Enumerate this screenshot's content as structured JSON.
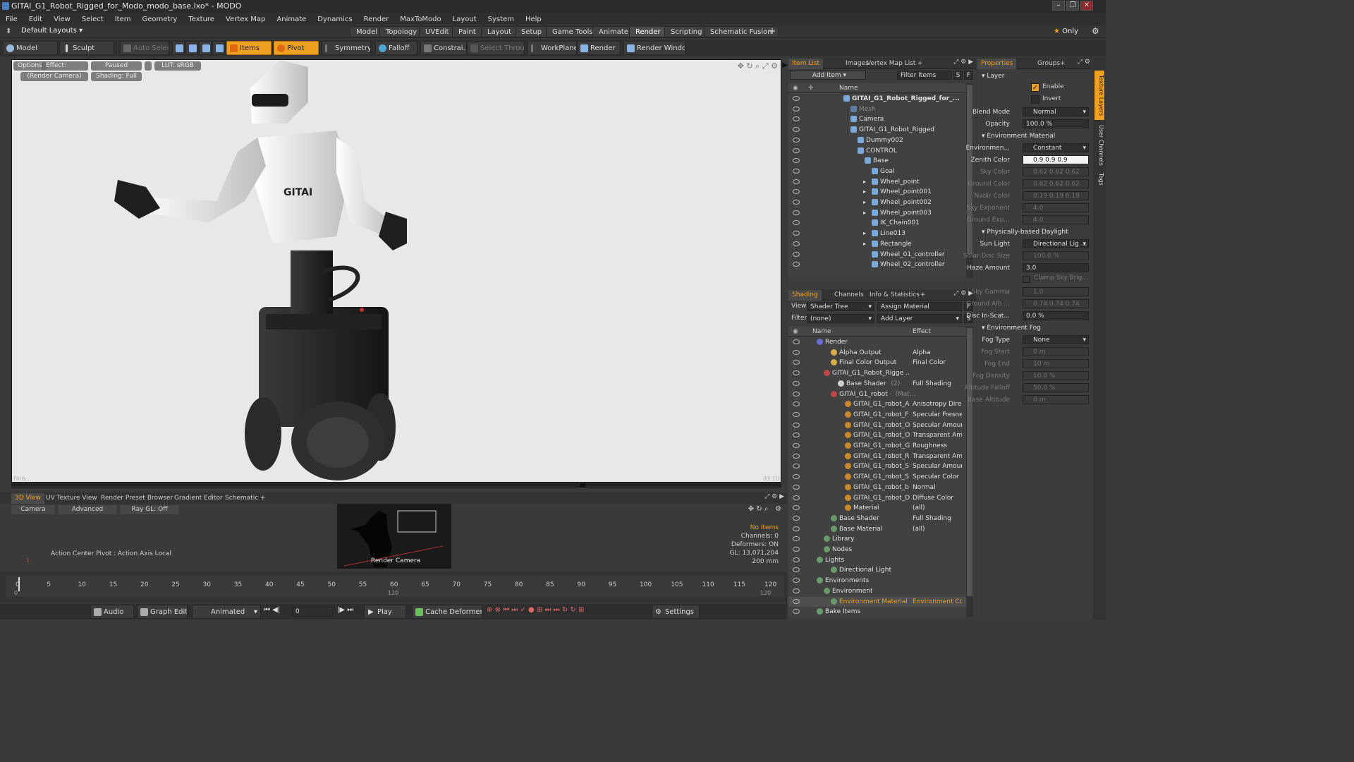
{
  "window": {
    "title": "GITAI_G1_Robot_Rigged_for_Modo_modo_base.lxo* - MODO"
  },
  "menu": [
    "File",
    "Edit",
    "View",
    "Select",
    "Item",
    "Geometry",
    "Texture",
    "Vertex Map",
    "Animate",
    "Dynamics",
    "Render",
    "MaxToModo",
    "Layout",
    "System",
    "Help"
  ],
  "layouts": {
    "current": "Default Layouts",
    "tabs": [
      "Model",
      "Topology",
      "UVEdit",
      "Paint",
      "Layout",
      "Setup",
      "Game Tools",
      "Animate",
      "Render",
      "Scripting",
      "Schematic Fusion"
    ],
    "active": "Render",
    "add": "+",
    "only": "Only"
  },
  "toolbar": {
    "model": "Model",
    "sculpt": "Sculpt",
    "auto_select": "Auto Select",
    "items": "Items",
    "pivot": "Pivot",
    "symmetry": "Symmetry",
    "falloff": "Falloff",
    "constrain": "Constrai...",
    "select_through": "Select Through",
    "workplane": "WorkPlane",
    "render": "Render",
    "render_window": "Render Window"
  },
  "viewport": {
    "options": "Options",
    "effect": "Effect: (Shadi...",
    "paused": "Paused",
    "lut": "LUT: sRGB",
    "camera": "(Render Camera)",
    "shading": "Shading: Full",
    "status_left": "Finis...",
    "status_right": "03:10",
    "robot_logo": "GITAI"
  },
  "itemlist": {
    "tabs": [
      "Item List",
      "Images",
      "Vertex Map List",
      "+"
    ],
    "add_item": "Add Item",
    "filter": "Filter Items",
    "s_btn": "S",
    "f_btn": "F",
    "col_name": "Name",
    "items": [
      {
        "label": "GITAI_G1_Robot_Rigged_for_...",
        "indent": 0,
        "bold": true
      },
      {
        "label": "Mesh",
        "indent": 1,
        "dim": true
      },
      {
        "label": "Camera",
        "indent": 1
      },
      {
        "label": "GITAI_G1_Robot_Rigged",
        "indent": 1
      },
      {
        "label": "Dummy002",
        "indent": 2
      },
      {
        "label": "CONTROL",
        "indent": 2
      },
      {
        "label": "Base",
        "indent": 3
      },
      {
        "label": "Goal",
        "indent": 4
      },
      {
        "label": "Wheel_point",
        "indent": 4
      },
      {
        "label": "Wheel_point001",
        "indent": 4
      },
      {
        "label": "Wheel_point002",
        "indent": 4
      },
      {
        "label": "Wheel_point003",
        "indent": 4
      },
      {
        "label": "IK_Chain001",
        "indent": 4
      },
      {
        "label": "Line013",
        "indent": 4
      },
      {
        "label": "Rectangle",
        "indent": 4
      },
      {
        "label": "Wheel_01_controller",
        "indent": 4
      },
      {
        "label": "Wheel_02_controller",
        "indent": 4
      }
    ]
  },
  "shading": {
    "tabs": [
      "Shading",
      "Channels",
      "Info & Statistics",
      "+"
    ],
    "view_label": "View",
    "view_value": "Shader Tree",
    "assign_material": "Assign Material",
    "f_btn": "F",
    "filter_label": "Filter",
    "filter_value": "(none)",
    "add_layer": "Add Layer",
    "s_btn": "S",
    "col_name": "Name",
    "col_effect": "Effect",
    "rows": [
      {
        "name": "Render",
        "effect": "",
        "indent": 0
      },
      {
        "name": "Alpha Output",
        "effect": "Alpha",
        "indent": 2
      },
      {
        "name": "Final Color Output",
        "effect": "Final Color",
        "indent": 2
      },
      {
        "name": "GITAI_G1_Robot_Rigge ...",
        "effect": "",
        "indent": 1
      },
      {
        "name": "Base Shader",
        "suffix": "(2)",
        "effect": "Full Shading",
        "indent": 3
      },
      {
        "name": "GITAI_G1_robot",
        "suffix": "(Mat...",
        "effect": "",
        "indent": 2
      },
      {
        "name": "GITAI_G1_robot_A ...",
        "effect": "Anisotropy Dire ...",
        "indent": 4
      },
      {
        "name": "GITAI_G1_robot_F ...",
        "effect": "Specular Fresnel",
        "indent": 4
      },
      {
        "name": "GITAI_G1_robot_O...",
        "effect": "Specular Amount",
        "indent": 4
      },
      {
        "name": "GITAI_G1_robot_O...",
        "effect": "Transparent Am...",
        "indent": 4
      },
      {
        "name": "GITAI_G1_robot_Gl...",
        "effect": "Roughness",
        "indent": 4
      },
      {
        "name": "GITAI_G1_robot_R ...",
        "effect": "Transparent Am...",
        "indent": 4
      },
      {
        "name": "GITAI_G1_robot_S ...",
        "effect": "Specular Amount",
        "indent": 4
      },
      {
        "name": "GITAI_G1_robot_S ...",
        "effect": "Specular Color",
        "indent": 4
      },
      {
        "name": "GITAI_G1_robot_b ...",
        "effect": "Normal",
        "indent": 4
      },
      {
        "name": "GITAI_G1_robot_Di...",
        "effect": "Diffuse Color",
        "indent": 4
      },
      {
        "name": "Material",
        "effect": "(all)",
        "indent": 4
      },
      {
        "name": "Base Shader",
        "effect": "Full Shading",
        "indent": 2
      },
      {
        "name": "Base Material",
        "effect": "(all)",
        "indent": 2
      },
      {
        "name": "Library",
        "effect": "",
        "indent": 1
      },
      {
        "name": "Nodes",
        "effect": "",
        "indent": 1
      },
      {
        "name": "Lights",
        "effect": "",
        "indent": 0
      },
      {
        "name": "Directional Light",
        "effect": "",
        "indent": 2
      },
      {
        "name": "Environments",
        "effect": "",
        "indent": 0
      },
      {
        "name": "Environment",
        "effect": "",
        "indent": 1
      },
      {
        "name": "Environment Material",
        "effect": "Environment Co...",
        "indent": 2,
        "selected": true
      },
      {
        "name": "Bake Items",
        "effect": "",
        "indent": 0
      }
    ]
  },
  "properties": {
    "tabs": [
      "Properties",
      "Groups",
      "+"
    ],
    "layer_section": "Layer",
    "enable": "Enable",
    "invert": "Invert",
    "blend_mode_label": "Blend Mode",
    "blend_mode": "Normal",
    "opacity_label": "Opacity",
    "opacity": "100.0 %",
    "env_material_section": "Environment Material",
    "env_type_label": "Environmen...",
    "env_type": "Constant",
    "zenith_label": "Zenith Color",
    "zenith": "0.9   0.9   0.9",
    "sky_label": "Sky Color",
    "sky": "0.62 0.62 0.62",
    "ground_label": "Ground Color",
    "ground": "0.62 0.62 0.62",
    "nadir_label": "Nadir Color",
    "nadir": "0.19 0.19 0.19",
    "sky_exp_label": "Sky Exponent",
    "sky_exp": "4.0",
    "ground_exp_label": "Ground Exp...",
    "ground_exp": "4.0",
    "daylight_section": "Physically-based Daylight",
    "sun_label": "Sun Light",
    "sun": "Directional Lig ...",
    "solar_label": "Solar Disc Size",
    "solar": "100.0 %",
    "haze_label": "Haze Amount",
    "haze": "3.0",
    "clamp": "Clamp Sky Brig...",
    "sky_gamma_label": "Sky Gamma",
    "sky_gamma": "1.0",
    "ground_alb_label": "Ground Alb ...",
    "ground_alb": "0.74 0.74 0.74",
    "disc_label": "Disc In-Scat...",
    "disc": "0.0 %",
    "fog_section": "Environment Fog",
    "fog_type_label": "Fog Type",
    "fog_type": "None",
    "fog_start_label": "Fog Start",
    "fog_start": "0 m",
    "fog_end_label": "Fog End",
    "fog_end": "10 m",
    "fog_density_label": "Fog Density",
    "fog_density": "10.0 %",
    "alt_falloff_label": "Altitude Falloff",
    "alt_falloff": "50.0 %",
    "base_alt_label": "Base Altitude",
    "base_alt": "0 m"
  },
  "side_tabs": [
    "Texture Layers",
    "User Channels",
    "Tags"
  ],
  "bottom": {
    "tabs": [
      "3D View",
      "UV Texture View",
      "Render Preset Browser",
      "Gradient Editor",
      "Schematic",
      "+"
    ],
    "camera_btn": "Camera",
    "advanced_btn": "Advanced",
    "raygl_btn": "Ray GL: Off",
    "action_center": "Action Center Pivot : Action Axis Local",
    "render_camera": "Render Camera",
    "no_items": "No Items",
    "channels": "Channels: 0",
    "deformers": "Deformers: ON",
    "gl": "GL: 13,071,204",
    "scale": "200 mm"
  },
  "timeline": {
    "ticks": [
      "0",
      "5",
      "10",
      "15",
      "20",
      "25",
      "30",
      "35",
      "40",
      "45",
      "50",
      "55",
      "60",
      "65",
      "70",
      "75",
      "80",
      "85",
      "90",
      "95",
      "100",
      "105",
      "110",
      "115",
      "120"
    ],
    "lower_left": "0",
    "lower_mid": "120",
    "lower_right": "120"
  },
  "transport": {
    "audio": "Audio",
    "graph_editor": "Graph Editor",
    "animated": "Animated",
    "frame": "0",
    "play": "Play",
    "cache_deformers": "Cache Deformers",
    "settings": "Settings"
  },
  "colors": {
    "accent": "#f0a020",
    "selected_text": "#f0a020"
  }
}
